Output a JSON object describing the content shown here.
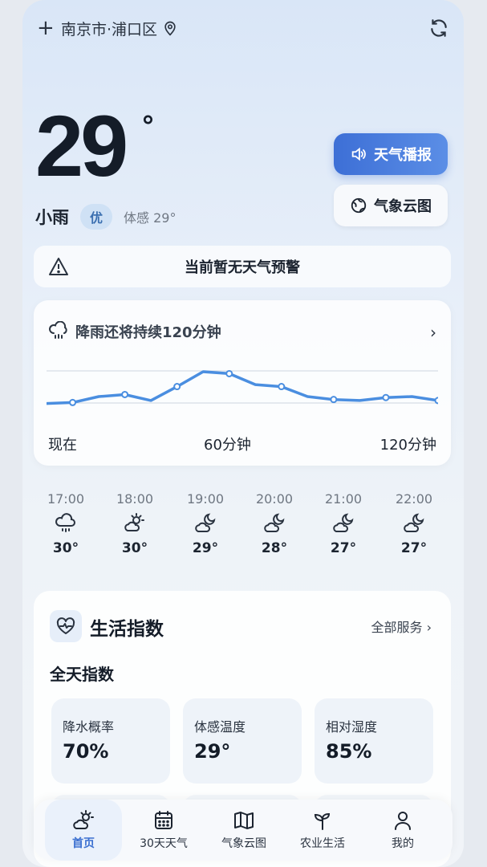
{
  "header": {
    "add_symbol": "+",
    "location": "南京市·浦口区",
    "pin_icon": "location-pin-icon",
    "refresh_icon": "refresh-icon"
  },
  "current": {
    "temperature": "29",
    "degree": "°",
    "condition": "小雨",
    "aqi": "优",
    "feels_like": "体感 29°"
  },
  "actions": {
    "broadcast_label": "天气播报",
    "cloud_label": "气象云图"
  },
  "alert": {
    "text": "当前暂无天气预警"
  },
  "rain": {
    "title": "降雨还将持续120分钟",
    "axis": {
      "start": "现在",
      "mid": "60分钟",
      "end": "120分钟"
    }
  },
  "chart_data": {
    "type": "line",
    "title": "降雨还将持续120分钟",
    "x_labels": [
      "现在",
      "60分钟",
      "120分钟"
    ],
    "x": [
      0,
      8,
      16,
      24,
      32,
      40,
      48,
      56,
      64,
      72,
      80,
      88,
      96,
      104,
      112,
      120
    ],
    "values": [
      0.28,
      0.3,
      0.42,
      0.46,
      0.34,
      0.62,
      0.92,
      0.88,
      0.66,
      0.62,
      0.42,
      0.36,
      0.34,
      0.4,
      0.42,
      0.34
    ],
    "grid": true
  },
  "hourly": [
    {
      "time": "17:00",
      "icon": "rain-cloud-icon",
      "temp": "30°"
    },
    {
      "time": "18:00",
      "icon": "sun-cloud-icon",
      "temp": "30°"
    },
    {
      "time": "19:00",
      "icon": "moon-cloud-icon",
      "temp": "29°"
    },
    {
      "time": "20:00",
      "icon": "moon-cloud-icon",
      "temp": "28°"
    },
    {
      "time": "21:00",
      "icon": "moon-cloud-icon",
      "temp": "27°"
    },
    {
      "time": "22:00",
      "icon": "moon-cloud-icon",
      "temp": "27°"
    }
  ],
  "life": {
    "title": "生活指数",
    "all_services": "全部服务 ›",
    "section": "全天指数",
    "indices": [
      {
        "label": "降水概率",
        "value": "70%"
      },
      {
        "label": "体感温度",
        "value": "29°"
      },
      {
        "label": "相对湿度",
        "value": "85%"
      }
    ]
  },
  "tabs": [
    {
      "label": "首页",
      "icon": "home-weather-icon",
      "active": true
    },
    {
      "label": "30天天气",
      "icon": "calendar-icon",
      "active": false
    },
    {
      "label": "气象云图",
      "icon": "map-icon",
      "active": false
    },
    {
      "label": "农业生活",
      "icon": "sprout-icon",
      "active": false
    },
    {
      "label": "我的",
      "icon": "user-icon",
      "active": false
    }
  ],
  "colors": {
    "accent": "#3d6fd6",
    "line": "#4a8ee0",
    "active_tab": "#3a6fd0"
  }
}
